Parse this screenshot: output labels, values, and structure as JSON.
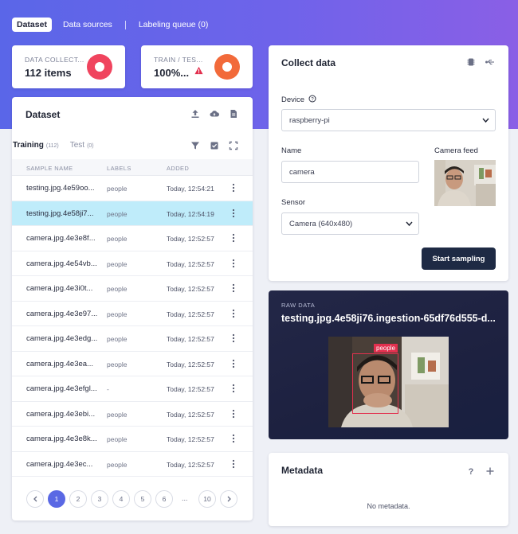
{
  "top_tabs": [
    "Dataset",
    "Data sources",
    "Labeling queue (0)"
  ],
  "stats": {
    "data_collected": {
      "label": "DATA COLLECT...",
      "value": "112 items"
    },
    "train_test": {
      "label": "TRAIN / TES...",
      "value": "100%..."
    }
  },
  "dataset": {
    "title": "Dataset",
    "tabs": {
      "training": "Training",
      "training_count": "(112)",
      "test": "Test",
      "test_count": "(0)"
    },
    "columns": [
      "SAMPLE NAME",
      "LABELS",
      "ADDED"
    ],
    "rows": [
      {
        "name": "testing.jpg.4e59oo...",
        "label": "people",
        "added": "Today, 12:54:21"
      },
      {
        "name": "testing.jpg.4e58ji7...",
        "label": "people",
        "added": "Today, 12:54:19"
      },
      {
        "name": "camera.jpg.4e3e8f...",
        "label": "people",
        "added": "Today, 12:52:57"
      },
      {
        "name": "camera.jpg.4e54vb...",
        "label": "people",
        "added": "Today, 12:52:57"
      },
      {
        "name": "camera.jpg.4e3i0t...",
        "label": "people",
        "added": "Today, 12:52:57"
      },
      {
        "name": "camera.jpg.4e3e97...",
        "label": "people",
        "added": "Today, 12:52:57"
      },
      {
        "name": "camera.jpg.4e3edg...",
        "label": "people",
        "added": "Today, 12:52:57"
      },
      {
        "name": "camera.jpg.4e3ea...",
        "label": "people",
        "added": "Today, 12:52:57"
      },
      {
        "name": "camera.jpg.4e3efgl...",
        "label": "-",
        "added": "Today, 12:52:57"
      },
      {
        "name": "camera.jpg.4e3ebi...",
        "label": "people",
        "added": "Today, 12:52:57"
      },
      {
        "name": "camera.jpg.4e3e8k...",
        "label": "people",
        "added": "Today, 12:52:57"
      },
      {
        "name": "camera.jpg.4e3ec...",
        "label": "people",
        "added": "Today, 12:52:57"
      }
    ],
    "pagination": {
      "pages": [
        "1",
        "2",
        "3",
        "4",
        "5",
        "6"
      ],
      "ellipsis": "...",
      "last": "10",
      "current": "1"
    }
  },
  "collect": {
    "title": "Collect data",
    "device_label": "Device",
    "device_value": "raspberry-pi",
    "name_label": "Name",
    "name_value": "camera",
    "camera_feed_label": "Camera feed",
    "sensor_label": "Sensor",
    "sensor_value": "Camera (640x480)",
    "start_button": "Start sampling"
  },
  "raw": {
    "kicker": "RAW DATA",
    "title": "testing.jpg.4e58ji76.ingestion-65df76d555-d...",
    "bbox_label": "people"
  },
  "metadata": {
    "title": "Metadata",
    "empty": "No metadata."
  },
  "colors": {
    "accent": "#5a68e4",
    "primary_button": "#1e2a44",
    "selected_row": "#bfecfa",
    "bbox": "#e2304e",
    "donut": "#f0445e"
  }
}
